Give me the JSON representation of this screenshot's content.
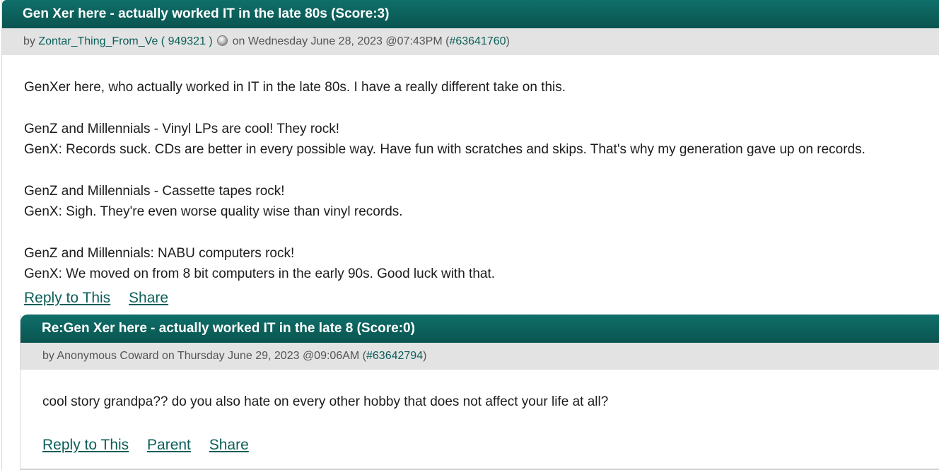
{
  "comment": {
    "title": "Gen Xer here - actually worked IT in the late 80s (Score:3)",
    "by_prefix": "by",
    "author": "Zontar_Thing_From_Ve",
    "user_id": "( 949321 )",
    "on_date": "on Wednesday June 28, 2023 @07:43PM (",
    "comment_id": "#63641760",
    "close_paren": ")",
    "paragraphs": [
      [
        "GenXer here, who actually worked in IT in the late 80s. I have a really different take on this."
      ],
      [
        "GenZ and Millennials - Vinyl LPs are cool! They rock!",
        "GenX: Records suck. CDs are better in every possible way. Have fun with scratches and skips. That's why my generation gave up on records."
      ],
      [
        "GenZ and Millennials - Cassette tapes rock!",
        "GenX: Sigh. They're even worse quality wise than vinyl records."
      ],
      [
        "GenZ and Millennials: NABU computers rock!",
        "GenX: We moved on from 8 bit computers in the early 90s. Good luck with that."
      ]
    ],
    "links": {
      "reply": "Reply to This",
      "share": "Share"
    }
  },
  "reply": {
    "title": "Re:Gen Xer here - actually worked IT in the late 8 (Score:0)",
    "meta_text": "by Anonymous Coward on Thursday June 29, 2023 @09:06AM (",
    "comment_id": "#63642794",
    "close_paren": ")",
    "body": "cool story grandpa?? do you also hate on every other hobby that does not affect your life at all?",
    "links": {
      "reply": "Reply to This",
      "parent": "Parent",
      "share": "Share"
    }
  },
  "colors": {
    "title_bar": "#0c625d",
    "meta_bar": "#e3e3e3",
    "link": "#0b5e58"
  }
}
